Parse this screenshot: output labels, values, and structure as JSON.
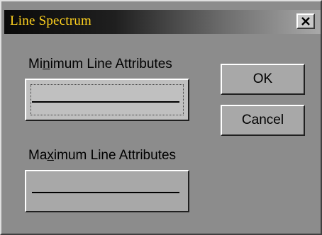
{
  "window": {
    "title": "Line Spectrum",
    "close_glyph": "✕",
    "close_icon": "close-icon"
  },
  "minimum": {
    "label_pre": "Mi",
    "label_mnemonic": "n",
    "label_post": "imum Line Attributes"
  },
  "maximum": {
    "label_pre": "Ma",
    "label_mnemonic": "x",
    "label_post": "imum Line Attributes"
  },
  "buttons": {
    "ok": "OK",
    "cancel": "Cancel"
  },
  "colors": {
    "title_text": "#ffd21f",
    "dialog_bg": "#8c8c8c",
    "button_face": "#a8a8a8"
  }
}
